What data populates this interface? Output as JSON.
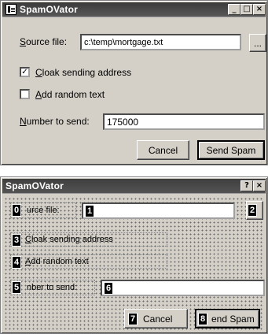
{
  "window": {
    "title": "SpamOVator",
    "minimize_glyph": "_",
    "maximize_glyph": "□",
    "close_glyph": "×",
    "source_label_underlined": "S",
    "source_label_rest": "ource file:",
    "source_value": "c:\\temp\\mortgage.txt",
    "browse_label": "...",
    "cloak_underlined": "C",
    "cloak_rest": "loak sending address",
    "cloak_check": "✓",
    "random_underlined": "A",
    "random_rest": "dd random text",
    "number_underlined": "N",
    "number_rest": "umber to send:",
    "number_value": "175000",
    "cancel_label": "Cancel",
    "send_label": "Send Spam"
  },
  "tab_window": {
    "title": "SpamOVator",
    "help_glyph": "?",
    "close_glyph": "×",
    "tab0": "0",
    "source_label": "urce file:",
    "tab1": "1",
    "tab2": "2",
    "tab3": "3",
    "cloak_underlined": "C",
    "cloak_rest": "loak sending address",
    "tab4": "4",
    "random_underlined": "A",
    "random_rest": "dd random text",
    "tab5": "5",
    "number_label": "nber to send:",
    "tab6": "6",
    "tab7": "7",
    "cancel_label": "Cancel",
    "tab8": "8",
    "send_label": "end Spam"
  }
}
